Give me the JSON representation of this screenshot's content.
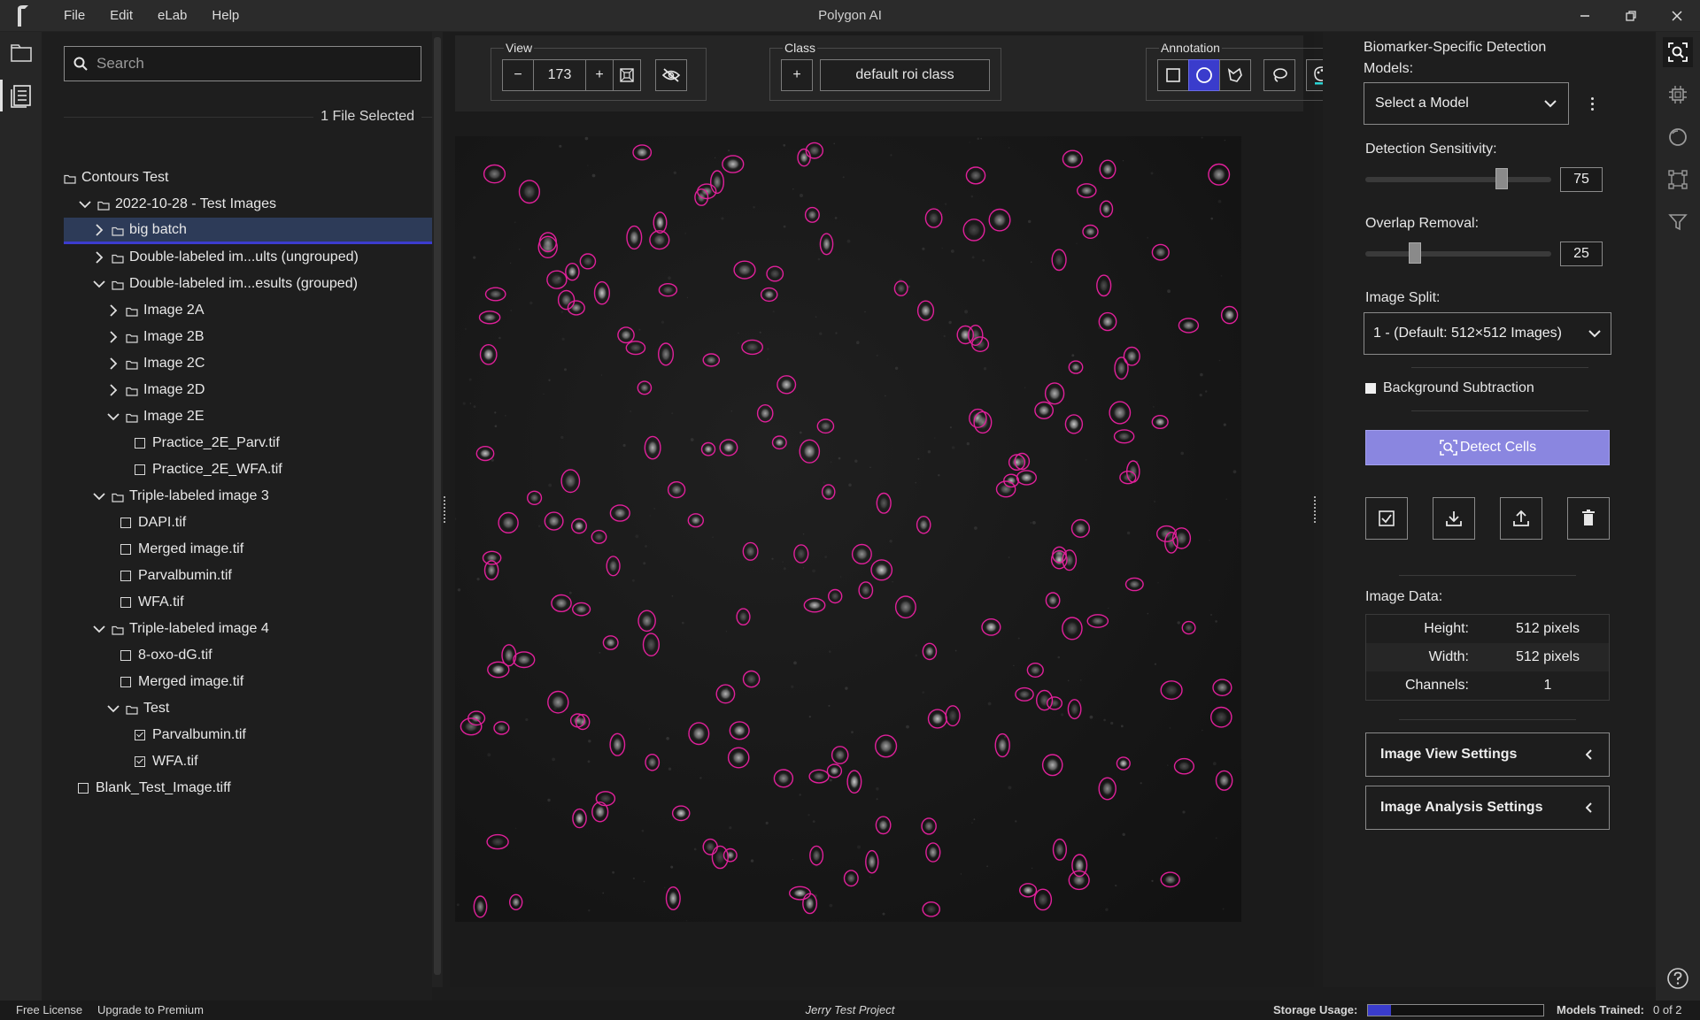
{
  "window": {
    "title": "Polygon AI",
    "menu": [
      "File",
      "Edit",
      "eLab",
      "Help"
    ],
    "controls": {
      "minimize": "—",
      "restore": "❐",
      "close": "✕"
    }
  },
  "left_rail": {
    "items": [
      "folder-icon",
      "document-list-icon"
    ]
  },
  "file_panel": {
    "search_placeholder": "Search",
    "selected_text": "1 File Selected",
    "tree": [
      {
        "label": "Contours Test",
        "type": "folder",
        "indent": 0,
        "chevron": "none"
      },
      {
        "label": "2022-10-28 - Test Images",
        "type": "folder",
        "indent": 1,
        "chevron": "down"
      },
      {
        "label": "big batch",
        "type": "folder",
        "indent": 2,
        "chevron": "right",
        "selected": true
      },
      {
        "label": "Double-labeled im...ults (ungrouped)",
        "type": "folder",
        "indent": 2,
        "chevron": "right"
      },
      {
        "label": "Double-labeled im...esults (grouped)",
        "type": "folder",
        "indent": 2,
        "chevron": "down"
      },
      {
        "label": "Image 2A",
        "type": "folder",
        "indent": 3,
        "chevron": "right"
      },
      {
        "label": "Image 2B",
        "type": "folder",
        "indent": 3,
        "chevron": "right"
      },
      {
        "label": "Image 2C",
        "type": "folder",
        "indent": 3,
        "chevron": "right"
      },
      {
        "label": "Image 2D",
        "type": "folder",
        "indent": 3,
        "chevron": "right"
      },
      {
        "label": "Image 2E",
        "type": "folder",
        "indent": 3,
        "chevron": "down"
      },
      {
        "label": "Practice_2E_Parv.tif",
        "type": "file",
        "indent": 5,
        "checked": false
      },
      {
        "label": "Practice_2E_WFA.tif",
        "type": "file",
        "indent": 5,
        "checked": false
      },
      {
        "label": "Triple-labeled image 3",
        "type": "folder",
        "indent": 2,
        "chevron": "down"
      },
      {
        "label": "DAPI.tif",
        "type": "file",
        "indent": 4,
        "checked": false
      },
      {
        "label": "Merged image.tif",
        "type": "file",
        "indent": 4,
        "checked": false
      },
      {
        "label": "Parvalbumin.tif",
        "type": "file",
        "indent": 4,
        "checked": false
      },
      {
        "label": "WFA.tif",
        "type": "file",
        "indent": 4,
        "checked": false
      },
      {
        "label": "Triple-labeled image 4",
        "type": "folder",
        "indent": 2,
        "chevron": "down"
      },
      {
        "label": "8-oxo-dG.tif",
        "type": "file",
        "indent": 4,
        "checked": false
      },
      {
        "label": "Merged image.tif",
        "type": "file",
        "indent": 4,
        "checked": false
      },
      {
        "label": "Test",
        "type": "folder",
        "indent": 3,
        "chevron": "down"
      },
      {
        "label": "Parvalbumin.tif",
        "type": "file",
        "indent": 5,
        "checked": true
      },
      {
        "label": "WFA.tif",
        "type": "file",
        "indent": 5,
        "checked": true
      },
      {
        "label": "Blank_Test_Image.tiff",
        "type": "file",
        "indent": 1,
        "checked": false
      }
    ]
  },
  "toolbar": {
    "view": {
      "label": "View",
      "minus": "−",
      "zoom": "173",
      "plus": "+"
    },
    "class": {
      "label": "Class",
      "add": "+",
      "name": "default roi class"
    },
    "annotation": {
      "label": "Annotation",
      "active_tool": "ellipse"
    }
  },
  "right_panel": {
    "models_label": "Biomarker-Specific Detection Models:",
    "model_select": "Select a Model",
    "sensitivity": {
      "label": "Detection Sensitivity:",
      "value": "75",
      "fraction": 0.75
    },
    "overlap": {
      "label": "Overlap Removal:",
      "value": "25",
      "fraction": 0.25
    },
    "split": {
      "label": "Image Split:",
      "value": "1 - (Default: 512×512 Images)"
    },
    "background_subtraction": "Background Subtraction",
    "detect_button": "Detect Cells",
    "image_data_label": "Image Data:",
    "image_data": [
      {
        "key": "Height:",
        "value": "512 pixels"
      },
      {
        "key": "Width:",
        "value": "512 pixels"
      },
      {
        "key": "Channels:",
        "value": "1"
      }
    ],
    "view_settings": "Image View Settings",
    "analysis_settings": "Image Analysis Settings"
  },
  "status": {
    "license": "Free License",
    "upgrade": "Upgrade to Premium",
    "project": "Jerry Test Project",
    "storage_label": "Storage Usage:",
    "storage_fraction": 0.13,
    "models_label": "Models Trained:",
    "models_value": "0 of 2"
  },
  "colors": {
    "accent": "#3a3ccc",
    "detect": "#8a86e0",
    "roi": "#e0209a"
  }
}
